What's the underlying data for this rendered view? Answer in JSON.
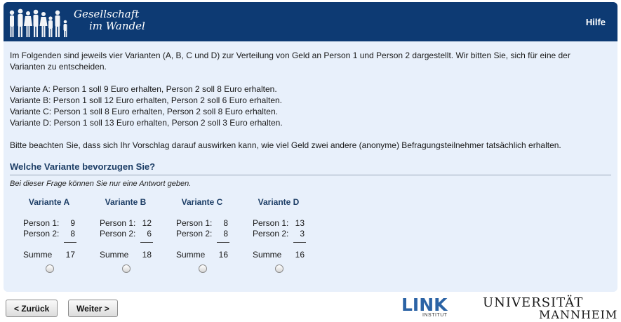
{
  "header": {
    "logo_line1": "Gesellschaft",
    "logo_line2": "im Wandel",
    "help_label": "Hilfe"
  },
  "intro_text": "Im Folgenden sind jeweils vier Varianten (A, B, C und D) zur Verteilung von Geld an Person 1 und Person 2 dargestellt. Wir bitten Sie, sich für eine der Varianten zu entscheiden.",
  "variant_lines": [
    "Variante A: Person 1 soll 9 Euro erhalten, Person 2 soll 8 Euro erhalten.",
    "Variante B: Person 1 soll 12 Euro erhalten, Person 2 soll 6 Euro erhalten.",
    "Variante C: Person 1 soll 8 Euro erhalten, Person 2 soll 8 Euro erhalten.",
    "Variante D: Person 1 soll 13 Euro erhalten, Person 2 soll 3 Euro erhalten."
  ],
  "note_text": "Bitte beachten Sie, dass sich Ihr Vorschlag darauf auswirken kann, wie viel Geld zwei andere (anonyme) Befragungsteilnehmer tatsächlich erhalten.",
  "question": {
    "title": "Welche Variante bevorzugen Sie?",
    "hint": "Bei dieser Frage können Sie nur eine Antwort geben."
  },
  "row_labels": {
    "person1": "Person 1:",
    "person2": "Person 2:",
    "sum": "Summe"
  },
  "options": [
    {
      "label": "Variante A",
      "person1": "9",
      "person2": "8",
      "sum": "17",
      "selected": false
    },
    {
      "label": "Variante B",
      "person1": "12",
      "person2": "6",
      "sum": "18",
      "selected": false
    },
    {
      "label": "Variante C",
      "person1": "8",
      "person2": "8",
      "sum": "16",
      "selected": false
    },
    {
      "label": "Variante D",
      "person1": "13",
      "person2": "3",
      "sum": "16",
      "selected": false
    }
  ],
  "nav": {
    "back_label": "< Zurück",
    "next_label": "Weiter >"
  },
  "footer": {
    "link_logo": "LINK",
    "link_sub": "INSTITUT",
    "uni_line1": "UNIVERSITÄT",
    "uni_line2": "MANNHEIM"
  },
  "colors": {
    "header_bg": "#0d3a73",
    "panel_bg": "#e8f0fb",
    "heading": "#1d3e66",
    "link_blue": "#2b63a5"
  }
}
